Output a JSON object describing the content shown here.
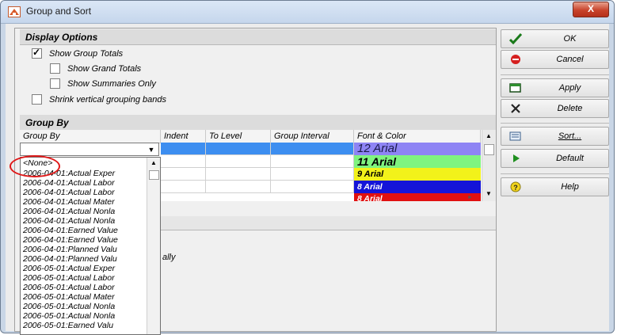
{
  "window": {
    "title": "Group and Sort",
    "close_label": "X"
  },
  "display_options": {
    "header": "Display Options",
    "checkboxes": [
      {
        "label": "Show Group Totals",
        "checked": true
      },
      {
        "label": "Show Grand Totals",
        "checked": false
      },
      {
        "label": "Show Summaries Only",
        "checked": false
      },
      {
        "label": "Shrink vertical grouping bands",
        "checked": false
      }
    ]
  },
  "group_by": {
    "header": "Group By",
    "columns": [
      "Group By",
      "Indent",
      "To Level",
      "Group Interval",
      "Font & Color"
    ],
    "fonts": [
      {
        "label": "12 Arial",
        "bg": "#8e84f4",
        "color": "#1a1a4a"
      },
      {
        "label": "11 Arial",
        "bg": "#7ff47f",
        "color": "#000000"
      },
      {
        "label": "9 Arial",
        "bg": "#f2f21a",
        "color": "#000000"
      },
      {
        "label": "8 Arial",
        "bg": "#1414d8",
        "color": "#ffffff"
      },
      {
        "label": "8 Arial",
        "bg": "#e01010",
        "color": "#ffffff"
      }
    ],
    "dropdown_items": [
      "<None>",
      "2006-04-01:Actual Exper",
      "2006-04-01:Actual Labor",
      "2006-04-01:Actual Labor",
      "2006-04-01:Actual Mater",
      "2006-04-01:Actual Nonla",
      "2006-04-01:Actual Nonla",
      "2006-04-01:Earned Value",
      "2006-04-01:Earned Value",
      "2006-04-01:Planned Valu",
      "2006-04-01:Planned Valu",
      "2006-05-01:Actual Exper",
      "2006-05-01:Actual Labor",
      "2006-05-01:Actual Labor",
      "2006-05-01:Actual Mater",
      "2006-05-01:Actual Nonla",
      "2006-05-01:Actual Nonla",
      "2006-05-01:Earned Valu"
    ],
    "partial_text": "ally"
  },
  "buttons": [
    {
      "label": "OK",
      "icon": "checkmark-icon"
    },
    {
      "label": "Cancel",
      "icon": "cancel-icon"
    },
    {
      "label": "Apply",
      "icon": "apply-icon"
    },
    {
      "label": "Delete",
      "icon": "delete-icon"
    },
    {
      "label": "Sort...",
      "icon": "sort-icon"
    },
    {
      "label": "Default",
      "icon": "play-icon"
    },
    {
      "label": "Help",
      "icon": "help-icon"
    }
  ]
}
